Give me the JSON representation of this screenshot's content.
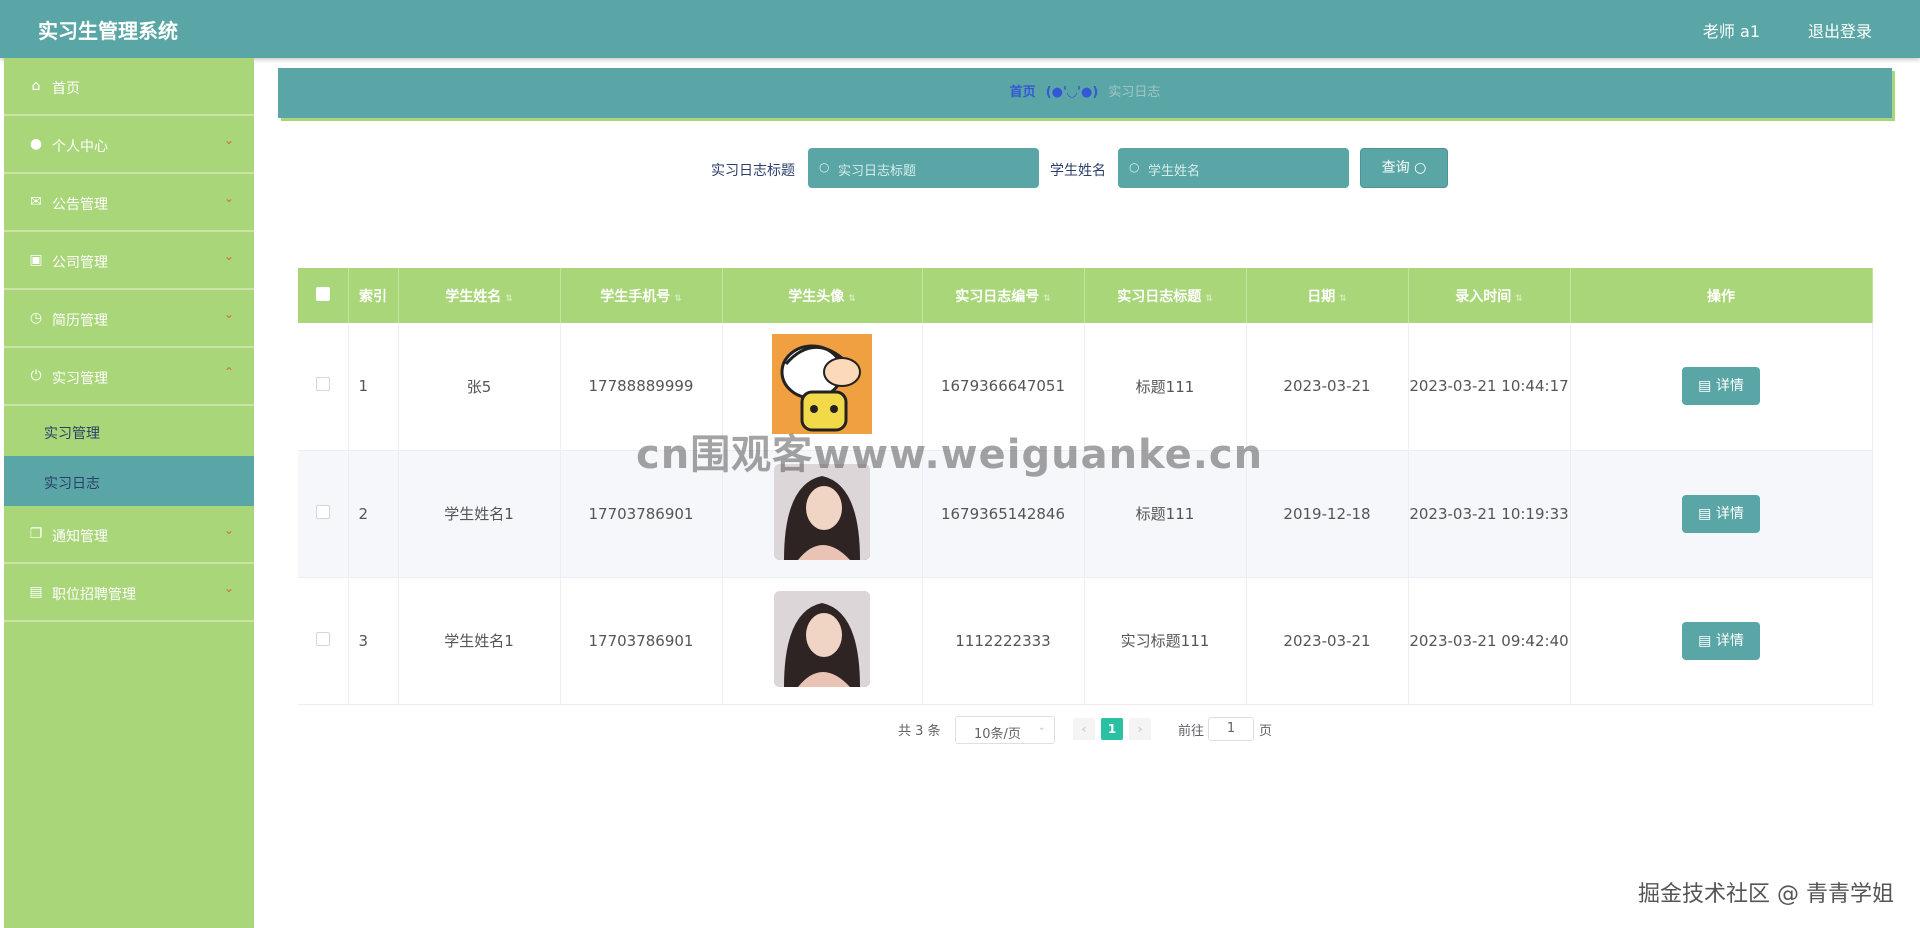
{
  "app": {
    "title": "实习生管理系统"
  },
  "topbar": {
    "user": "老师 a1",
    "logout": "退出登录"
  },
  "sidebar": {
    "items": [
      {
        "label": "首页",
        "icon": "home-icon",
        "glyph": "⌂",
        "arrow": ""
      },
      {
        "label": "个人中心",
        "icon": "user-icon",
        "glyph": "●",
        "arrow": "⌄"
      },
      {
        "label": "公告管理",
        "icon": "mail-icon",
        "glyph": "✉",
        "arrow": "⌄"
      },
      {
        "label": "公司管理",
        "icon": "chart-icon",
        "glyph": "▣",
        "arrow": "⌄"
      },
      {
        "label": "简历管理",
        "icon": "clock-icon",
        "glyph": "◷",
        "arrow": "⌄"
      },
      {
        "label": "实习管理",
        "icon": "power-icon",
        "glyph": "⏻",
        "arrow": "⌃"
      },
      {
        "label": "通知管理",
        "icon": "copy-icon",
        "glyph": "❐",
        "arrow": "⌄"
      },
      {
        "label": "职位招聘管理",
        "icon": "chat-icon",
        "glyph": "▤",
        "arrow": "⌄"
      }
    ],
    "sub_items": [
      {
        "label": "实习管理"
      },
      {
        "label": "实习日志"
      }
    ]
  },
  "breadcrumb": {
    "home": "首页",
    "separator": "(●'◡'●)",
    "current": "实习日志"
  },
  "search": {
    "title_label": "实习日志标题",
    "title_placeholder": "实习日志标题",
    "name_label": "学生姓名",
    "name_placeholder": "学生姓名",
    "query_button": "查询",
    "search_glyph": "○"
  },
  "table": {
    "headers": [
      "索引",
      "学生姓名",
      "学生手机号",
      "学生头像",
      "实习日志编号",
      "实习日志标题",
      "日期",
      "录入时间",
      "操作"
    ],
    "sort_glyph": "⇅",
    "detail_label": "详情",
    "detail_glyph": "▤",
    "rows": [
      {
        "index": "1",
        "name": "张5",
        "phone": "17788889999",
        "avatar": "cartoon-avatar",
        "log_no": "1679366647051",
        "log_title": "标题111",
        "date": "2023-03-21",
        "entry_time": "2023-03-21 10:44:17"
      },
      {
        "index": "2",
        "name": "学生姓名1",
        "phone": "17703786901",
        "avatar": "photo-avatar",
        "log_no": "1679365142846",
        "log_title": "标题111",
        "date": "2019-12-18",
        "entry_time": "2023-03-21 10:19:33"
      },
      {
        "index": "3",
        "name": "学生姓名1",
        "phone": "17703786901",
        "avatar": "photo-avatar",
        "log_no": "1112222333",
        "log_title": "实习标题111",
        "date": "2023-03-21",
        "entry_time": "2023-03-21 09:42:40"
      }
    ]
  },
  "pagination": {
    "total": "共 3 条",
    "page_size": "10条/页",
    "current_page": "1",
    "goto_label": "前往",
    "goto_value": "1",
    "page_suffix": "页",
    "prev_glyph": "‹",
    "next_glyph": "›"
  },
  "watermarks": {
    "center": "cn围观客www.weiguanke.cn",
    "corner": "掘金技术社区 @ 青青学姐"
  },
  "colors": {
    "teal": "#5aa6a6",
    "green": "#a8d678",
    "active_text": "#f4e56b",
    "page_active": "#2bbfa3"
  }
}
